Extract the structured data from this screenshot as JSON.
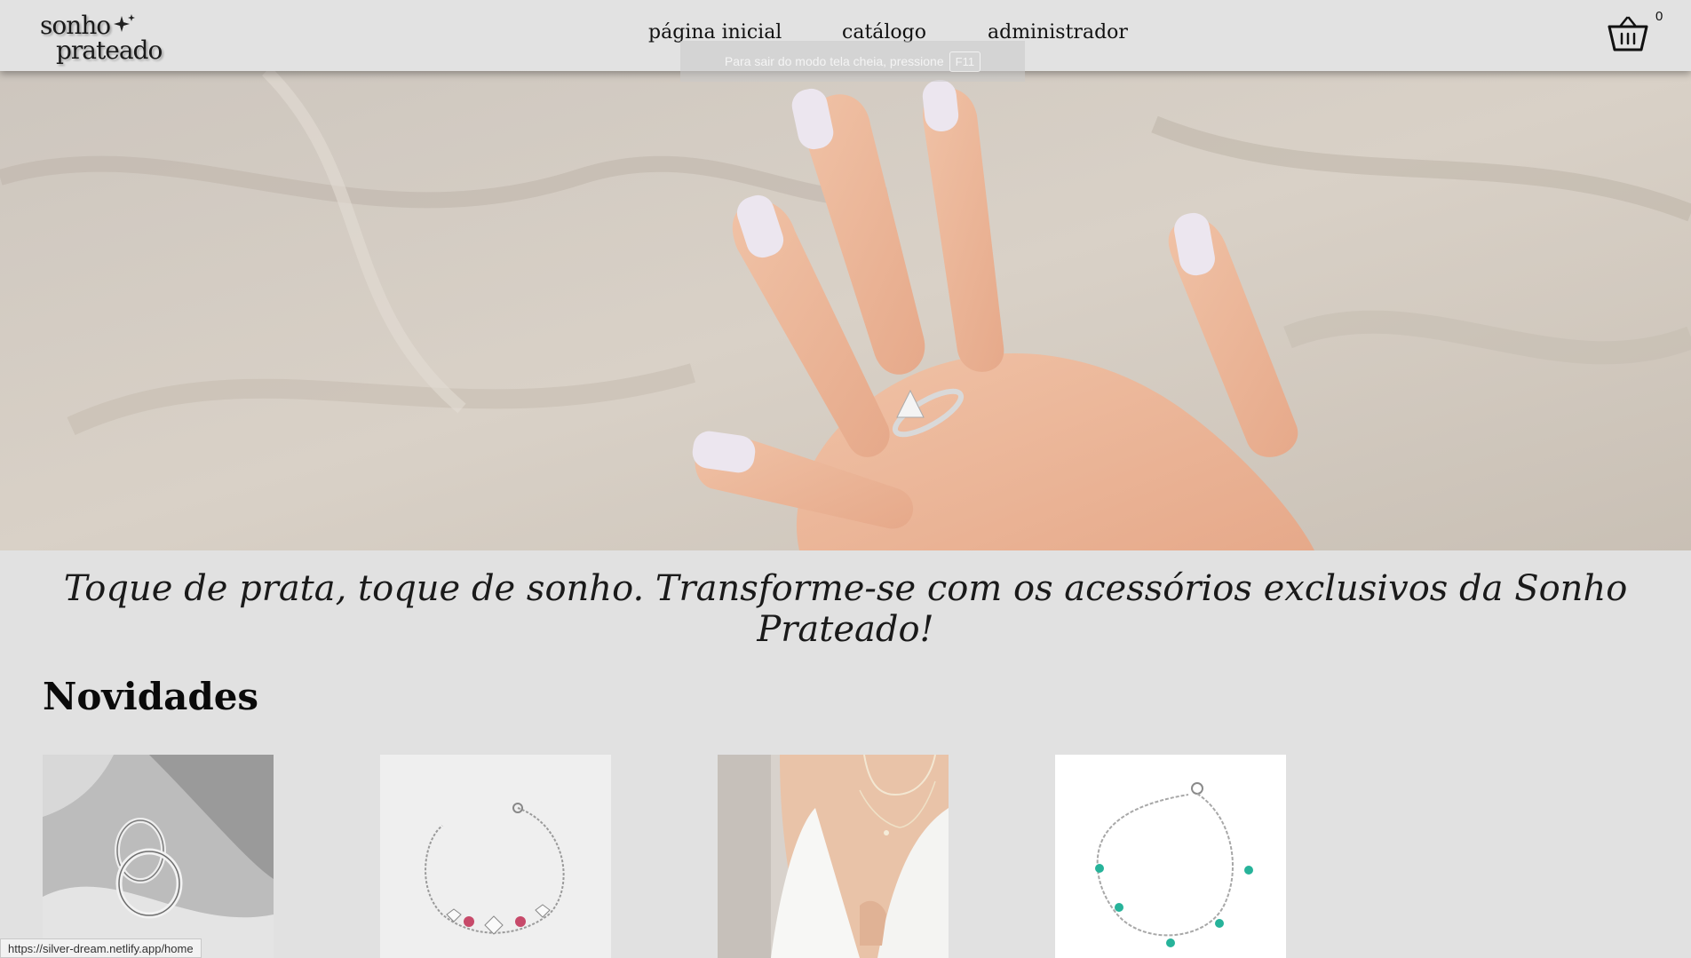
{
  "brand": {
    "line1": "sonho",
    "line2": "prateado"
  },
  "nav": {
    "home": "página inicial",
    "catalog": "catálogo",
    "admin": "administrador"
  },
  "cart": {
    "count": "0"
  },
  "fullscreen_notice": {
    "text": "Para sair do modo tela cheia, pressione",
    "key": "F11"
  },
  "hero": {
    "alt_icon": "hand-with-ring-on-sand-image"
  },
  "tagline": "Toque de prata, toque de sonho. Transforme-se com os acessórios exclusivos da Sonho Prateado!",
  "news": {
    "title": "Novidades",
    "products": [
      {
        "icon": "silver-hoop-earrings-image"
      },
      {
        "icon": "heart-charm-bracelet-image"
      },
      {
        "icon": "woman-wearing-necklace-image"
      },
      {
        "icon": "turquoise-charm-bracelet-image"
      }
    ]
  },
  "status_bar": {
    "url": "https://silver-dream.netlify.app/home"
  },
  "colors": {
    "background": "#e1e1e1",
    "header": "#e2e2e2",
    "text": "#111111"
  }
}
